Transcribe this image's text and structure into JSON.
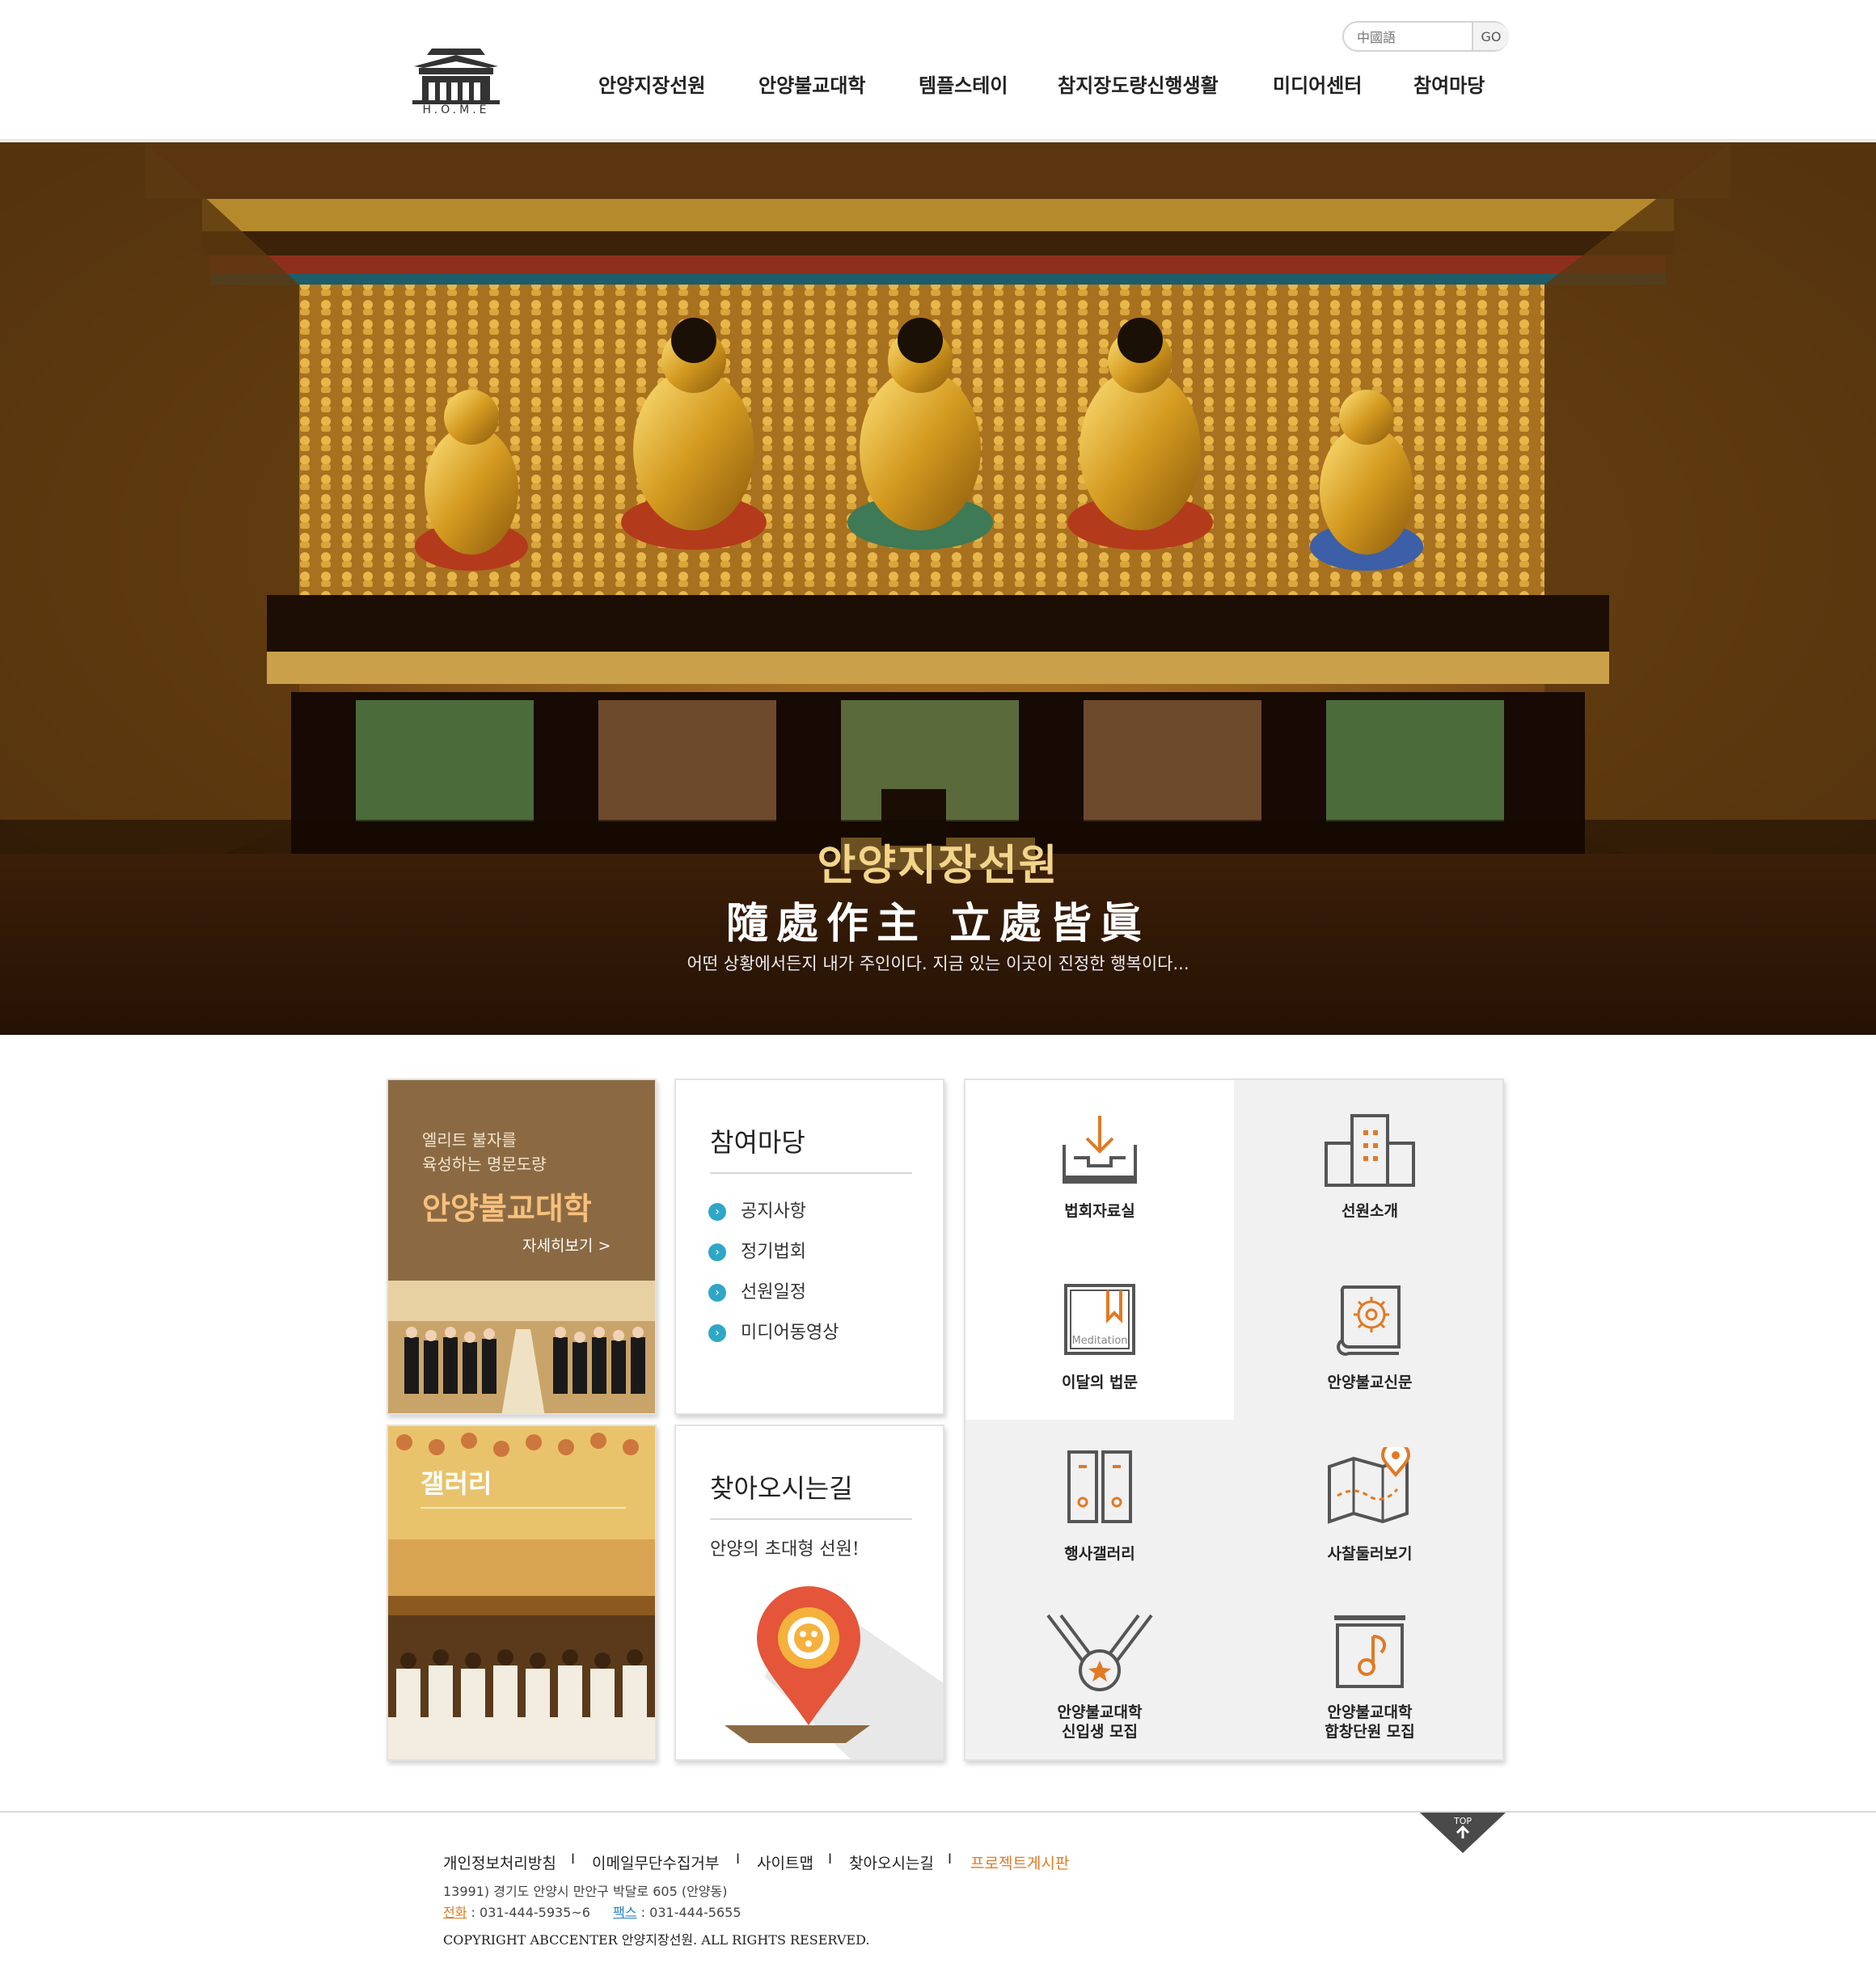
{
  "header": {
    "logo_text": "H.O.M.E",
    "search_placeholder": "中國語",
    "search_button": "GO",
    "nav": [
      "안양지장선원",
      "안양불교대학",
      "템플스테이",
      "참지장도량신행생활",
      "미디어센터",
      "참여마당"
    ]
  },
  "hero": {
    "title": "안양지장선원",
    "subtitle": "隨處作主  立處皆眞",
    "description": "어떤 상황에서든지 내가 주인이다. 지금 있는 이곳이 진정한 행복이다..."
  },
  "promo": {
    "line1": "엘리트 불자를",
    "line2": "육성하는 명문도량",
    "title": "안양불교대학",
    "more": "자세히보기 >"
  },
  "gallery": {
    "title": "갤러리"
  },
  "board": {
    "title": "참여마당",
    "items": [
      "공지사항",
      "정기법회",
      "선원일정",
      "미디어동영상"
    ]
  },
  "map": {
    "title": "찾아오시는길",
    "subtitle": "안양의 초대형 선원!"
  },
  "quick_links": {
    "items": [
      {
        "label": "법회자료실",
        "icon": "download-tray-icon"
      },
      {
        "label": "선원소개",
        "icon": "building-icon"
      },
      {
        "label": "이달의 법문",
        "icon": "bookmark-book-icon",
        "badge": "Meditation"
      },
      {
        "label": "안양불교신문",
        "icon": "lotus-book-icon"
      },
      {
        "label": "행사갤러리",
        "icon": "double-door-icon"
      },
      {
        "label": "사찰둘러보기",
        "icon": "map-pin-icon"
      },
      {
        "label": "안양불교대학",
        "label2": "신입생 모집",
        "icon": "medal-icon"
      },
      {
        "label": "안양불교대학",
        "label2": "합창단원 모집",
        "icon": "music-note-icon"
      }
    ]
  },
  "footer": {
    "links": [
      "개인정보처리방침",
      "이메일무단수집거부",
      "사이트맵",
      "찾아오시는길",
      "프로젝트게시판"
    ],
    "separator": "I",
    "address": "13991) 경기도 안양시 만안구 박달로 605 (안양동)",
    "phone_label": "전화",
    "phone": " : 031-444-5935~6",
    "fax_label": "팩스",
    "fax": " : 031-444-5655",
    "copyright": "COPYRIGHT ABCCENTER 안양지장선원. ALL RIGHTS RESERVED.",
    "top_label": "TOP"
  },
  "colors": {
    "accent_orange": "#e07a25",
    "promo_brown": "#8b6a43",
    "promo_title": "#f7c07c",
    "bullet_teal": "#2fa6c6",
    "hero_gold": "#f2d58a"
  }
}
